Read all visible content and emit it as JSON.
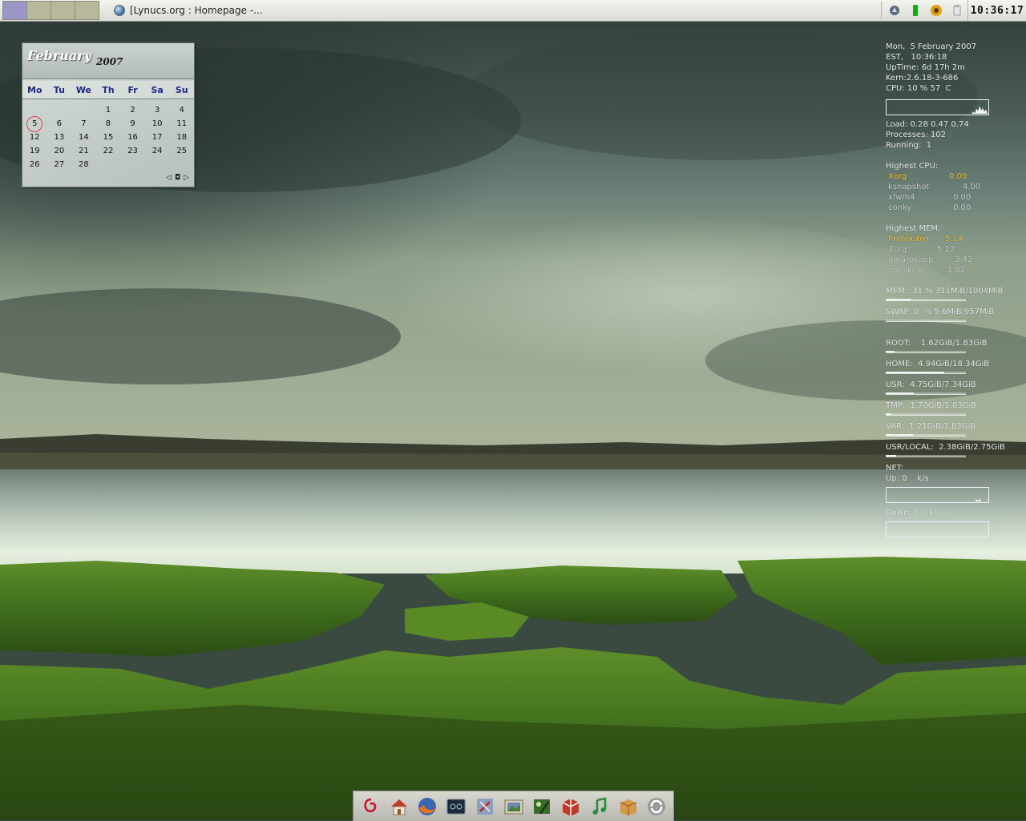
{
  "top_panel": {
    "task_title": "[Lynucs.org : Homepage -...",
    "clock": "10:36:17"
  },
  "calendar": {
    "month": "February",
    "year": "2007",
    "weekdays": [
      "Mo",
      "Tu",
      "We",
      "Th",
      "Fr",
      "Sa",
      "Su"
    ],
    "leading_blanks": 3,
    "days": [
      "1",
      "2",
      "3",
      "4",
      "5",
      "6",
      "7",
      "8",
      "9",
      "10",
      "11",
      "12",
      "13",
      "14",
      "15",
      "16",
      "17",
      "18",
      "19",
      "20",
      "21",
      "22",
      "23",
      "24",
      "25",
      "26",
      "27",
      "28"
    ],
    "today": "5",
    "nav": {
      "prev": "◁",
      "today": "◘",
      "next": "▷"
    }
  },
  "conky": {
    "date_line": "Mon,  5 February 2007",
    "time_line": "EST,   10:36:18",
    "uptime_line": "UpTime: 6d 17h 2m",
    "kern_line": "Kern:2.6.18-3-686",
    "cpu_line": "CPU: 10 % 57  C",
    "load_line": "Load: 0.28 0.47 0.74",
    "processes_line": "Processes: 102",
    "running_line": "Running:  1",
    "highest_cpu_label": "Highest CPU:",
    "highest_cpu": [
      {
        "name": "Xorg",
        "value": "0.00"
      },
      {
        "name": "ksnapshot",
        "value": "4.00"
      },
      {
        "name": "xfwm4",
        "value": "0.00"
      },
      {
        "name": "conky",
        "value": "0.00"
      }
    ],
    "highest_mem_label": "Highest MEM:",
    "highest_mem": [
      {
        "name": "firefox-bin",
        "value": "5.14"
      },
      {
        "name": "Xorg",
        "value": "5.12"
      },
      {
        "name": "amarokapp",
        "value": "3.42"
      },
      {
        "name": "gdeskcal",
        "value": "1.82"
      }
    ],
    "mem_line": "MEM:  31 % 311MiB/1004MiB",
    "mem_fraction": 0.31,
    "swap_line": "SWAP: 0  % 5.6MiB/957MiB",
    "swap_fraction": 0.0,
    "filesystems": [
      {
        "label": "ROOT:    1.62GiB/1.83GiB",
        "fraction": 0.11
      },
      {
        "label": "HOME:  4.94GiB/18.34GiB",
        "fraction": 0.73
      },
      {
        "label": "USR:  4.75GiB/7.34GiB",
        "fraction": 0.35
      },
      {
        "label": "TMP:  1.70GiB/1.83GiB",
        "fraction": 0.07
      },
      {
        "label": "VAR:  1.21GiB/1.83GiB",
        "fraction": 0.34
      },
      {
        "label": "USR/LOCAL:  2.38GiB/2.75GiB",
        "fraction": 0.13
      }
    ],
    "net_label": "NET:",
    "up_line": "Up: 0    k/s",
    "down_line": "Down: 0    k/s"
  },
  "dock": {
    "items": [
      {
        "name": "debian-menu-icon"
      },
      {
        "name": "home-folder-icon"
      },
      {
        "name": "firefox-icon"
      },
      {
        "name": "terminal-icon"
      },
      {
        "name": "settings-tools-icon"
      },
      {
        "name": "image-viewer-icon"
      },
      {
        "name": "graphics-editor-icon"
      },
      {
        "name": "package-box-icon"
      },
      {
        "name": "music-player-icon"
      },
      {
        "name": "archive-manager-icon"
      },
      {
        "name": "update-manager-icon"
      }
    ]
  }
}
